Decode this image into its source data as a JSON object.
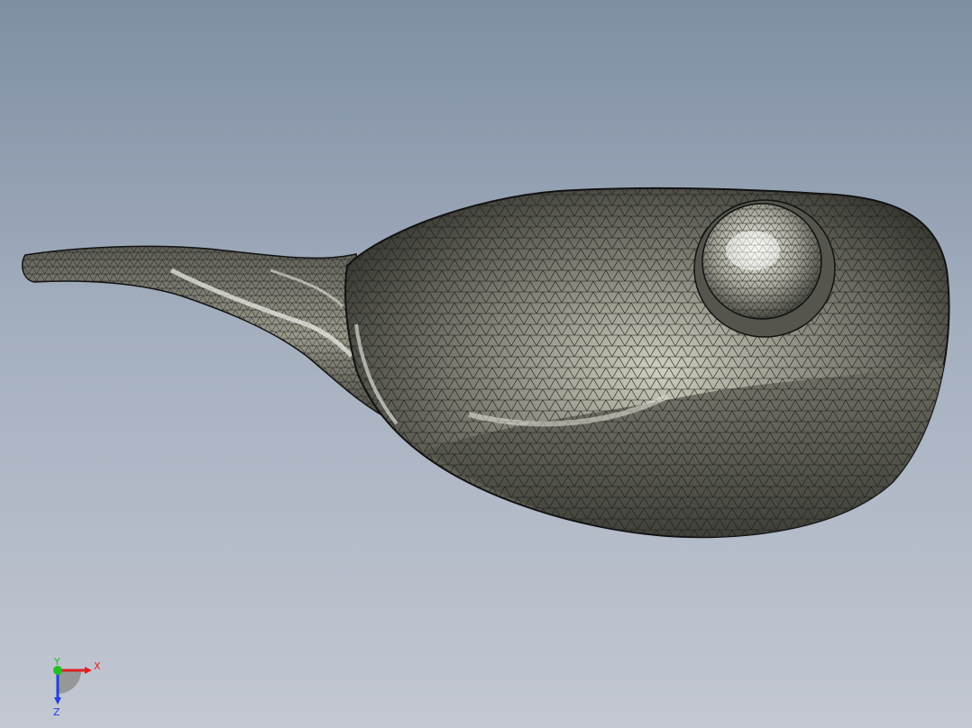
{
  "viewport": {
    "colors": {
      "background_top": "#7f8ea3",
      "background_bottom": "#c3c8d2",
      "mesh_line": "#1b1b1b",
      "surface_dark": "#3e3e38",
      "surface_mid": "#77776c",
      "surface_light": "#cfcfbf"
    }
  },
  "triad": {
    "x_label": "X",
    "y_label": "Y",
    "z_label": "Z",
    "colors": {
      "x": "#e02020",
      "y": "#20c020",
      "z": "#2040e0"
    }
  }
}
